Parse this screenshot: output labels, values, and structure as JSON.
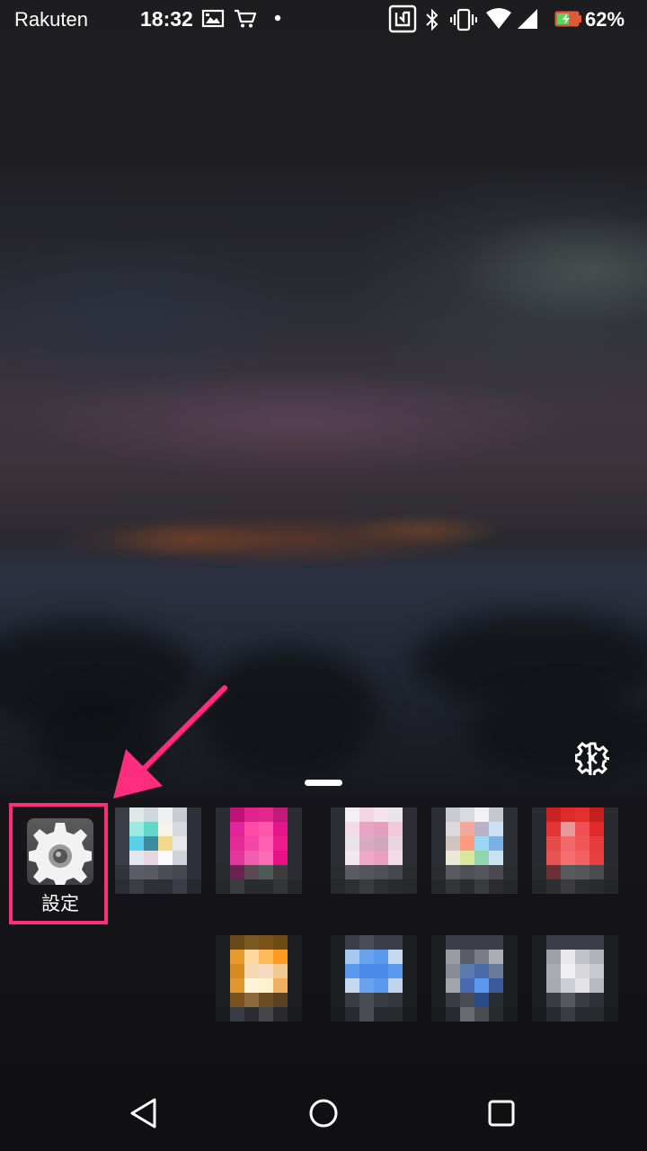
{
  "status_bar": {
    "carrier": "Rakuten",
    "time": "18:32",
    "battery_percent": "62%",
    "notification_icons": [
      "gallery-icon",
      "shopping-cart-icon",
      "dot-icon"
    ],
    "system_icons": [
      "nfc-icon",
      "bluetooth-icon",
      "vibrate-icon",
      "wifi-icon",
      "signal-icon",
      "battery-charging-icon"
    ]
  },
  "drawer": {
    "settings_app": {
      "label": "設定",
      "icon": "gear-icon"
    },
    "other_apps_pixelated": 9
  },
  "annotation": {
    "color": "#ff2d7e"
  },
  "nav_bar": {
    "buttons": [
      "back-icon",
      "home-icon",
      "recents-icon"
    ]
  }
}
